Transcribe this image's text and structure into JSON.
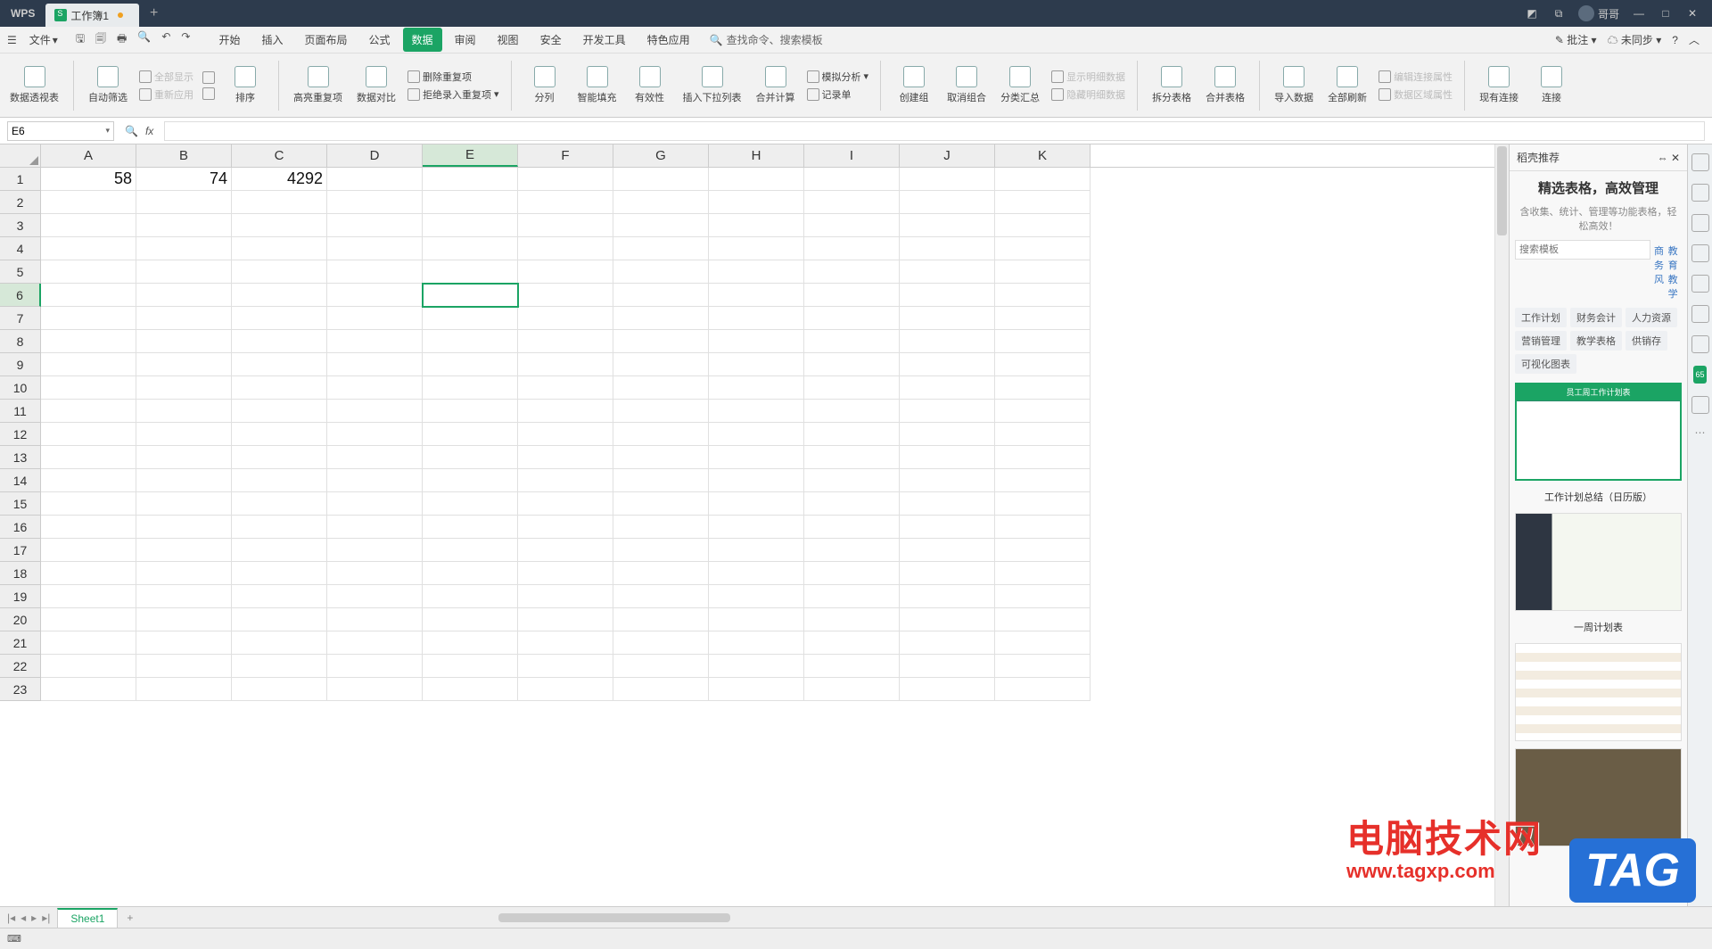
{
  "titlebar": {
    "logo": "WPS",
    "tab_name": "工作簿1",
    "user_name": "哥哥"
  },
  "menubar": {
    "file": "文件",
    "tabs": [
      "开始",
      "插入",
      "页面布局",
      "公式",
      "数据",
      "审阅",
      "视图",
      "安全",
      "开发工具",
      "特色应用"
    ],
    "active_tab_index": 4,
    "search_placeholder": "查找命令、搜索模板",
    "right": {
      "comment": "批注",
      "sync": "未同步"
    }
  },
  "ribbon": {
    "pivot": "数据透视表",
    "autofilter": "自动筛选",
    "show_all": "全部显示",
    "reapply": "重新应用",
    "sort": "排序",
    "highlight_dup": "高亮重复项",
    "data_compare": "数据对比",
    "remove_dup": "删除重复项",
    "reject_dup": "拒绝录入重复项",
    "text_to_col": "分列",
    "smart_fill": "智能填充",
    "validation": "有效性",
    "insert_dropdown": "插入下拉列表",
    "consolidate": "合并计算",
    "sim_analysis": "模拟分析",
    "form": "记录单",
    "group": "创建组",
    "ungroup": "取消组合",
    "subtotal": "分类汇总",
    "show_detail": "显示明细数据",
    "hide_detail": "隐藏明细数据",
    "split_table": "拆分表格",
    "merge_table": "合并表格",
    "import_data": "导入数据",
    "refresh_all": "全部刷新",
    "edit_conn": "编辑连接属性",
    "data_range": "数据区域属性",
    "existing_conn": "现有连接",
    "connections": "连接"
  },
  "formula": {
    "cell_ref": "E6",
    "value": ""
  },
  "grid": {
    "columns": [
      "A",
      "B",
      "C",
      "D",
      "E",
      "F",
      "G",
      "H",
      "I",
      "J",
      "K"
    ],
    "active_col_index": 4,
    "rows": [
      1,
      2,
      3,
      4,
      5,
      6,
      7,
      8,
      9,
      10,
      11,
      12,
      13,
      14,
      15,
      16,
      17,
      18,
      19,
      20,
      21,
      22,
      23
    ],
    "active_row_index": 5,
    "data": {
      "A1": "58",
      "B1": "74",
      "C1": "4292"
    },
    "selected": "E6"
  },
  "side": {
    "header": "稻壳推荐",
    "title": "精选表格，高效管理",
    "subtitle": "含收集、统计、管理等功能表格，轻松高效！",
    "search_placeholder": "搜索模板",
    "links": [
      "商务风",
      "教育教学"
    ],
    "tags": [
      "工作计划",
      "财务会计",
      "人力资源",
      "营销管理",
      "教学表格",
      "供销存",
      "可视化图表"
    ],
    "tpl1_hdr": "员工周工作计划表",
    "tpl2_label": "工作计划总结（日历版）",
    "tpl3_label": "一周计划表"
  },
  "right_strip": {
    "badge": "65"
  },
  "sheet": {
    "name": "Sheet1"
  },
  "watermark": {
    "line1": "电脑技术网",
    "line2": "www.tagxp.com",
    "tag": "TAG"
  }
}
